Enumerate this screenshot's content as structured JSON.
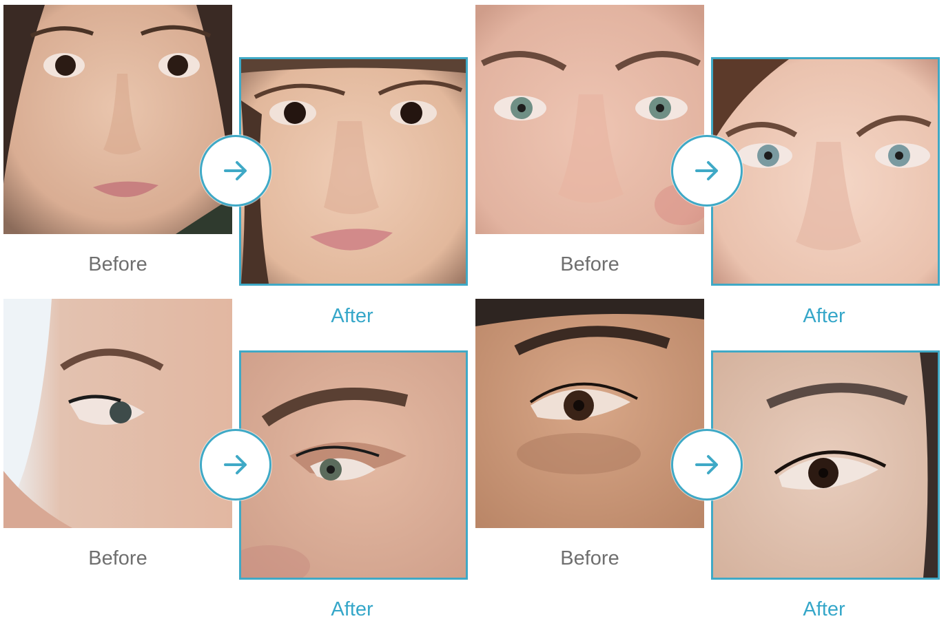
{
  "accent_color": "#3fa9c6",
  "before_label_color": "#6f6f6f",
  "pairs": [
    {
      "before_label": "Before",
      "after_label": "After",
      "arrow_icon": "arrow-right-icon"
    },
    {
      "before_label": "Before",
      "after_label": "After",
      "arrow_icon": "arrow-right-icon"
    },
    {
      "before_label": "Before",
      "after_label": "After",
      "arrow_icon": "arrow-right-icon"
    },
    {
      "before_label": "Before",
      "after_label": "After",
      "arrow_icon": "arrow-right-icon"
    }
  ]
}
